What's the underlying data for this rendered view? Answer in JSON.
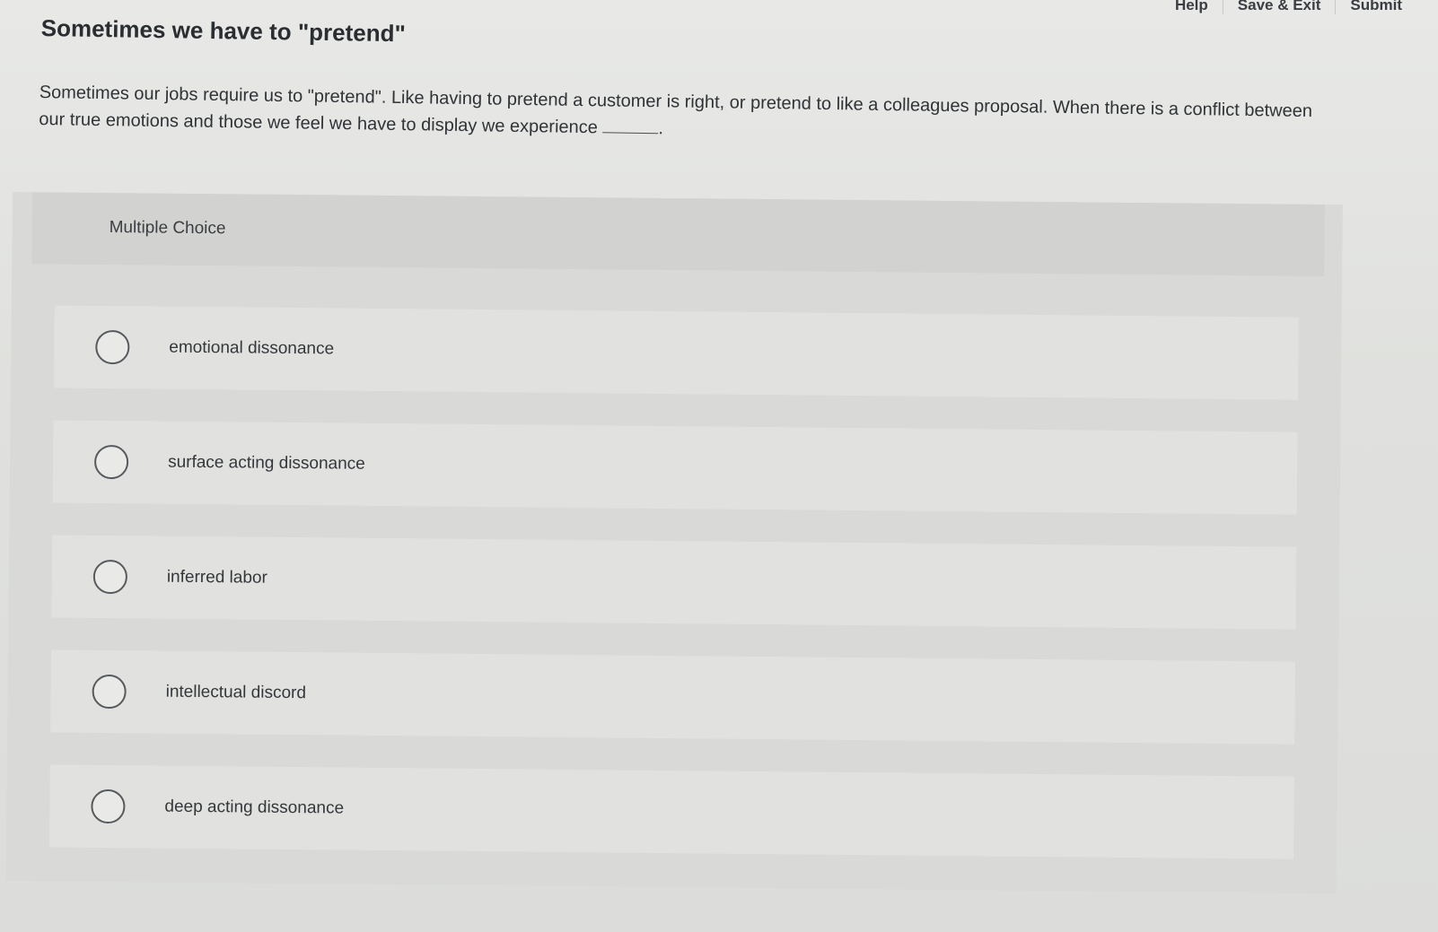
{
  "topbar": {
    "help_label": "Help",
    "save_exit_label": "Save & Exit",
    "submit_label": "Submit"
  },
  "question": {
    "title": "Sometimes we have to \"pretend\"",
    "prompt": "Sometimes our jobs require us to \"pretend\".  Like having to pretend a customer is right, or pretend to like a colleagues proposal.  When there is a conflict between our true emotions and those we feel we have to display we experience",
    "prompt_end": "."
  },
  "multiple_choice": {
    "label": "Multiple Choice",
    "options": [
      {
        "label": "emotional dissonance"
      },
      {
        "label": "surface acting dissonance"
      },
      {
        "label": "inferred labor"
      },
      {
        "label": "intellectual discord"
      },
      {
        "label": "deep acting dissonance"
      }
    ]
  }
}
